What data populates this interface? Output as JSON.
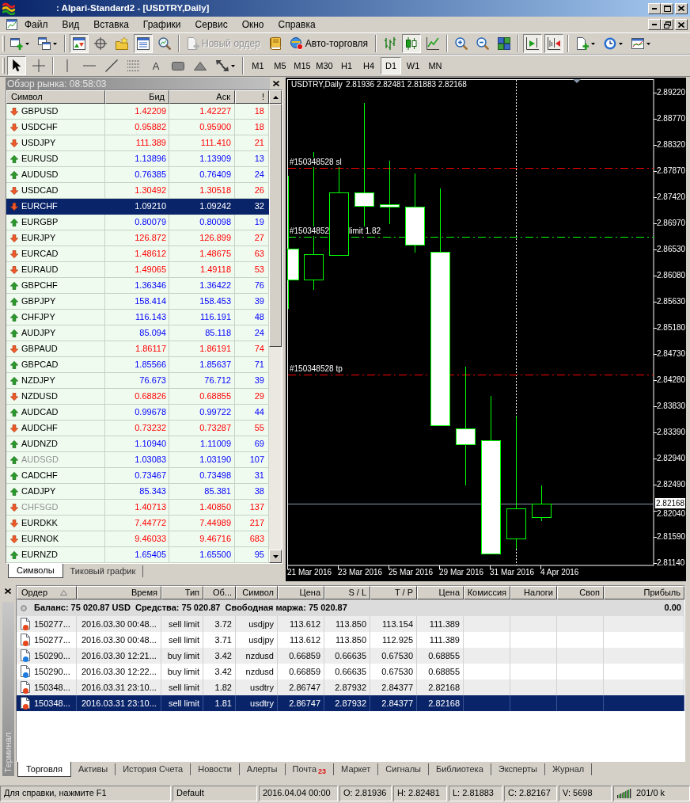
{
  "window": {
    "title": ": Alpari-Standard2 - [USDTRY,Daily]"
  },
  "menu": [
    "Файл",
    "Вид",
    "Вставка",
    "Графики",
    "Сервис",
    "Окно",
    "Справка"
  ],
  "toolbar_main": [
    [
      {
        "kind": "new_chart",
        "pressed": false
      },
      {
        "kind": "profiles",
        "pressed": false
      }
    ],
    [
      {
        "kind": "market_watch",
        "pressed": true
      },
      {
        "kind": "navigator",
        "pressed": false
      },
      {
        "kind": "favorites",
        "pressed": false
      },
      {
        "kind": "terminal",
        "pressed": true
      },
      {
        "kind": "tester",
        "pressed": false
      }
    ],
    [
      {
        "kind": "new_order",
        "label": "Новый ордер",
        "disabled": true
      },
      {
        "kind": "editor",
        "pressed": false
      },
      {
        "kind": "autotrade",
        "label": "Авто-торговля",
        "disabled": false
      }
    ],
    [
      {
        "kind": "bar_chart",
        "pressed": false
      },
      {
        "kind": "candles",
        "pressed": true
      },
      {
        "kind": "line_chart",
        "pressed": false
      }
    ],
    [
      {
        "kind": "zoom_in",
        "pressed": false
      },
      {
        "kind": "zoom_out",
        "pressed": false
      },
      {
        "kind": "tile",
        "pressed": false
      }
    ],
    [
      {
        "kind": "autoscroll",
        "pressed": true
      },
      {
        "kind": "shift",
        "pressed": true
      }
    ],
    [
      {
        "kind": "indicators",
        "pressed": false
      },
      {
        "kind": "periods",
        "pressed": false
      },
      {
        "kind": "templates",
        "pressed": false
      }
    ]
  ],
  "toolbar_tools": [
    [
      {
        "kind": "cursor",
        "pressed": true
      },
      {
        "kind": "crosshair",
        "pressed": false
      }
    ],
    [
      {
        "kind": "vline",
        "pressed": false
      },
      {
        "kind": "hline",
        "pressed": false
      },
      {
        "kind": "trendline",
        "pressed": false
      },
      {
        "kind": "fibo",
        "pressed": false
      },
      {
        "kind": "text",
        "label": "A",
        "pressed": false
      },
      {
        "kind": "label",
        "pressed": false
      },
      {
        "kind": "shapes",
        "pressed": false
      },
      {
        "kind": "arrows",
        "pressed": false
      }
    ]
  ],
  "timeframes": [
    {
      "label": "M1",
      "selected": false
    },
    {
      "label": "M5",
      "selected": false
    },
    {
      "label": "M15",
      "selected": false
    },
    {
      "label": "M30",
      "selected": false
    },
    {
      "label": "H1",
      "selected": false
    },
    {
      "label": "H4",
      "selected": false
    },
    {
      "label": "D1",
      "selected": true
    },
    {
      "label": "W1",
      "selected": false
    },
    {
      "label": "MN",
      "selected": false
    }
  ],
  "market_watch": {
    "title": "Обзор рынка: 08:58:03",
    "columns": [
      "Символ",
      "Бид",
      "Аск",
      "!"
    ],
    "rows": [
      {
        "symbol": "GBPUSD",
        "bid": "1.42209",
        "ask": "1.42227",
        "spread": "18",
        "rising": false,
        "dimmed": false,
        "selected": false
      },
      {
        "symbol": "USDCHF",
        "bid": "0.95882",
        "ask": "0.95900",
        "spread": "18",
        "rising": false,
        "dimmed": false,
        "selected": false
      },
      {
        "symbol": "USDJPY",
        "bid": "111.389",
        "ask": "111.410",
        "spread": "21",
        "rising": false,
        "dimmed": false,
        "selected": false
      },
      {
        "symbol": "EURUSD",
        "bid": "1.13896",
        "ask": "1.13909",
        "spread": "13",
        "rising": true,
        "dimmed": false,
        "selected": false
      },
      {
        "symbol": "AUDUSD",
        "bid": "0.76385",
        "ask": "0.76409",
        "spread": "24",
        "rising": true,
        "dimmed": false,
        "selected": false
      },
      {
        "symbol": "USDCAD",
        "bid": "1.30492",
        "ask": "1.30518",
        "spread": "26",
        "rising": false,
        "dimmed": false,
        "selected": false
      },
      {
        "symbol": "EURCHF",
        "bid": "1.09210",
        "ask": "1.09242",
        "spread": "32",
        "rising": false,
        "dimmed": false,
        "selected": true
      },
      {
        "symbol": "EURGBP",
        "bid": "0.80079",
        "ask": "0.80098",
        "spread": "19",
        "rising": true,
        "dimmed": false,
        "selected": false
      },
      {
        "symbol": "EURJPY",
        "bid": "126.872",
        "ask": "126.899",
        "spread": "27",
        "rising": false,
        "dimmed": false,
        "selected": false
      },
      {
        "symbol": "EURCAD",
        "bid": "1.48612",
        "ask": "1.48675",
        "spread": "63",
        "rising": false,
        "dimmed": false,
        "selected": false
      },
      {
        "symbol": "EURAUD",
        "bid": "1.49065",
        "ask": "1.49118",
        "spread": "53",
        "rising": false,
        "dimmed": false,
        "selected": false
      },
      {
        "symbol": "GBPCHF",
        "bid": "1.36346",
        "ask": "1.36422",
        "spread": "76",
        "rising": true,
        "dimmed": false,
        "selected": false
      },
      {
        "symbol": "GBPJPY",
        "bid": "158.414",
        "ask": "158.453",
        "spread": "39",
        "rising": true,
        "dimmed": false,
        "selected": false
      },
      {
        "symbol": "CHFJPY",
        "bid": "116.143",
        "ask": "116.191",
        "spread": "48",
        "rising": true,
        "dimmed": false,
        "selected": false
      },
      {
        "symbol": "AUDJPY",
        "bid": "85.094",
        "ask": "85.118",
        "spread": "24",
        "rising": true,
        "dimmed": false,
        "selected": false
      },
      {
        "symbol": "GBPAUD",
        "bid": "1.86117",
        "ask": "1.86191",
        "spread": "74",
        "rising": false,
        "dimmed": false,
        "selected": false
      },
      {
        "symbol": "GBPCAD",
        "bid": "1.85566",
        "ask": "1.85637",
        "spread": "71",
        "rising": true,
        "dimmed": false,
        "selected": false
      },
      {
        "symbol": "NZDJPY",
        "bid": "76.673",
        "ask": "76.712",
        "spread": "39",
        "rising": true,
        "dimmed": false,
        "selected": false
      },
      {
        "symbol": "NZDUSD",
        "bid": "0.68826",
        "ask": "0.68855",
        "spread": "29",
        "rising": false,
        "dimmed": false,
        "selected": false
      },
      {
        "symbol": "AUDCAD",
        "bid": "0.99678",
        "ask": "0.99722",
        "spread": "44",
        "rising": true,
        "dimmed": false,
        "selected": false
      },
      {
        "symbol": "AUDCHF",
        "bid": "0.73232",
        "ask": "0.73287",
        "spread": "55",
        "rising": false,
        "dimmed": false,
        "selected": false
      },
      {
        "symbol": "AUDNZD",
        "bid": "1.10940",
        "ask": "1.11009",
        "spread": "69",
        "rising": true,
        "dimmed": false,
        "selected": false
      },
      {
        "symbol": "AUDSGD",
        "bid": "1.03083",
        "ask": "1.03190",
        "spread": "107",
        "rising": true,
        "dimmed": true,
        "selected": false
      },
      {
        "symbol": "CADCHF",
        "bid": "0.73467",
        "ask": "0.73498",
        "spread": "31",
        "rising": true,
        "dimmed": false,
        "selected": false
      },
      {
        "symbol": "CADJPY",
        "bid": "85.343",
        "ask": "85.381",
        "spread": "38",
        "rising": true,
        "dimmed": false,
        "selected": false
      },
      {
        "symbol": "CHFSGD",
        "bid": "1.40713",
        "ask": "1.40850",
        "spread": "137",
        "rising": false,
        "dimmed": true,
        "selected": false
      },
      {
        "symbol": "EURDKK",
        "bid": "7.44772",
        "ask": "7.44989",
        "spread": "217",
        "rising": false,
        "dimmed": false,
        "selected": false
      },
      {
        "symbol": "EURNOK",
        "bid": "9.46033",
        "ask": "9.46716",
        "spread": "683",
        "rising": false,
        "dimmed": false,
        "selected": false
      },
      {
        "symbol": "EURNZD",
        "bid": "1.65405",
        "ask": "1.65500",
        "spread": "95",
        "rising": true,
        "dimmed": false,
        "selected": false
      }
    ],
    "tabs": [
      {
        "label": "Символы",
        "selected": true
      },
      {
        "label": "Тиковый график",
        "selected": false
      }
    ]
  },
  "chart": {
    "symbol": "USDTRY,Daily",
    "ohlc": "2.81936 2.82481 2.81883 2.82168",
    "price_labels": [
      "2.89220",
      "2.88770",
      "2.88320",
      "2.87870",
      "2.87420",
      "2.86970",
      "2.86530",
      "2.86080",
      "2.85630",
      "2.85180",
      "2.84730",
      "2.84280",
      "2.83830",
      "2.83390",
      "2.82940",
      "2.82490",
      "2.82040",
      "2.81590",
      "2.81140"
    ],
    "current_price": "2.82168",
    "date_labels": [
      "21 Mar 2016",
      "23 Mar 2016",
      "25 Mar 2016",
      "29 Mar 2016",
      "31 Mar 2016",
      "4 Apr 2016"
    ],
    "order_lines": [
      {
        "kind": "sl",
        "labels": [
          "#150348528 sl"
        ]
      },
      {
        "kind": "limit",
        "labels": [
          "#15034852",
          "limit 1.82"
        ]
      },
      {
        "kind": "tp",
        "labels": [
          "#150348528 tp"
        ]
      }
    ]
  },
  "terminal": {
    "side_label": "Терминал",
    "columns": [
      {
        "label": "Ордер",
        "sorted": true
      },
      {
        "label": "Время",
        "sorted": false
      },
      {
        "label": "Тип",
        "sorted": false
      },
      {
        "label": "Об...",
        "sorted": false
      },
      {
        "label": "Символ",
        "sorted": false
      },
      {
        "label": "Цена",
        "sorted": false
      },
      {
        "label": "S / L",
        "sorted": false
      },
      {
        "label": "T / P",
        "sorted": false
      },
      {
        "label": "Цена",
        "sorted": false
      },
      {
        "label": "Комиссия",
        "sorted": false
      },
      {
        "label": "Налоги",
        "sorted": false
      },
      {
        "label": "Своп",
        "sorted": false
      },
      {
        "label": "Прибыль",
        "sorted": false
      }
    ],
    "balance": {
      "text": "Баланс: 75 020.87 USD  Средства: 75 020.87  Свободная маржа: 75 020.87",
      "profit": "0.00"
    },
    "orders": [
      {
        "order": "150277...",
        "time": "2016.03.30 00:48...",
        "type": "sell limit",
        "volume": "3.72",
        "symbol": "usdjpy",
        "price": "113.612",
        "sl": "113.850",
        "tp": "113.154",
        "current_price": "111.389",
        "color": "#e8461c",
        "selected": false
      },
      {
        "order": "150277...",
        "time": "2016.03.30 00:48...",
        "type": "sell limit",
        "volume": "3.71",
        "symbol": "usdjpy",
        "price": "113.612",
        "sl": "113.850",
        "tp": "112.925",
        "current_price": "111.389",
        "color": "#e8461c",
        "selected": false
      },
      {
        "order": "150290...",
        "time": "2016.03.30 12:21...",
        "type": "buy limit",
        "volume": "3.42",
        "symbol": "nzdusd",
        "price": "0.66859",
        "sl": "0.66635",
        "tp": "0.67530",
        "current_price": "0.68855",
        "color": "#1c7ce0",
        "selected": false
      },
      {
        "order": "150290...",
        "time": "2016.03.30 12:22...",
        "type": "buy limit",
        "volume": "3.42",
        "symbol": "nzdusd",
        "price": "0.66859",
        "sl": "0.66635",
        "tp": "0.67530",
        "current_price": "0.68855",
        "color": "#1c7ce0",
        "selected": false
      },
      {
        "order": "150348...",
        "time": "2016.03.31 23:10...",
        "type": "sell limit",
        "volume": "1.82",
        "symbol": "usdtry",
        "price": "2.86747",
        "sl": "2.87932",
        "tp": "2.84377",
        "current_price": "2.82168",
        "color": "#e8461c",
        "selected": false
      },
      {
        "order": "150348...",
        "time": "2016.03.31 23:10...",
        "type": "sell limit",
        "volume": "1.81",
        "symbol": "usdtry",
        "price": "2.86747",
        "sl": "2.87932",
        "tp": "2.84377",
        "current_price": "2.82168",
        "color": "#e8461c",
        "selected": true
      }
    ],
    "tabs": [
      {
        "label": "Торговля",
        "selected": true
      },
      {
        "label": "Активы",
        "selected": false
      },
      {
        "label": "История Счета",
        "selected": false
      },
      {
        "label": "Новости",
        "selected": false
      },
      {
        "label": "Алерты",
        "selected": false
      },
      {
        "label": "Почта",
        "badge": "23",
        "selected": false
      },
      {
        "label": "Маркет",
        "selected": false
      },
      {
        "label": "Сигналы",
        "selected": false
      },
      {
        "label": "Библиотека",
        "selected": false
      },
      {
        "label": "Эксперты",
        "selected": false
      },
      {
        "label": "Журнал",
        "selected": false
      }
    ]
  },
  "status_bar": {
    "help": "Для справки, нажмите F1",
    "profile": "Default",
    "datetime": "2016.04.04 00:00",
    "quotes": [
      "O: 2.81936",
      "H: 2.82481",
      "L: 2.81883",
      "C: 2.82167",
      "V: 5698"
    ],
    "traffic": "201/0 k"
  }
}
